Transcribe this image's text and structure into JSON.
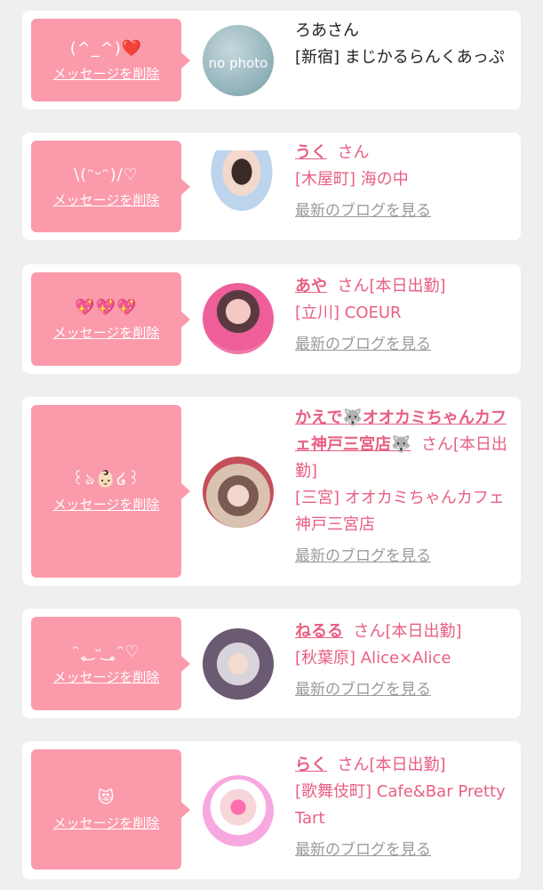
{
  "delete_label": "メッセージを削除",
  "blog_label": "最新のブログを見る",
  "items": [
    {
      "message": "(^_^)❤️",
      "avatar_text": "no photo",
      "name": "ろあ",
      "san": "さん",
      "status": "",
      "shop": "[新宿] まじかるらんくあっぷ"
    },
    {
      "message": "\\(ᵔᵕᵔ)/♡",
      "name": "うく",
      "san": "さん",
      "status": "",
      "shop": "[木屋町] 海の中"
    },
    {
      "message": "💖💖💖",
      "name": "あや",
      "san": "さん",
      "status": "[本日出勤]",
      "shop": "[立川] COEUR"
    },
    {
      "message": "꒰ঌ👶🏻໒꒱",
      "name": "かえで🐺オオカミちゃんカフェ神戸三宮店🐺",
      "san": "さん",
      "status": "[本日出勤]",
      "shop": "[三宮] オオカミちゃんカフェ神戸三宮店"
    },
    {
      "message": "ᵔ˳͜ ᵕ ͜˳ᵔ♡",
      "name": "ねるる",
      "san": "さん",
      "status": "[本日出勤]",
      "shop": "[秋葉原] Alice×Alice"
    },
    {
      "message": "😻",
      "name": "らく",
      "san": "さん",
      "status": "[本日出勤]",
      "shop": "[歌舞伎町] Cafe&Bar Pretty Tart"
    }
  ]
}
